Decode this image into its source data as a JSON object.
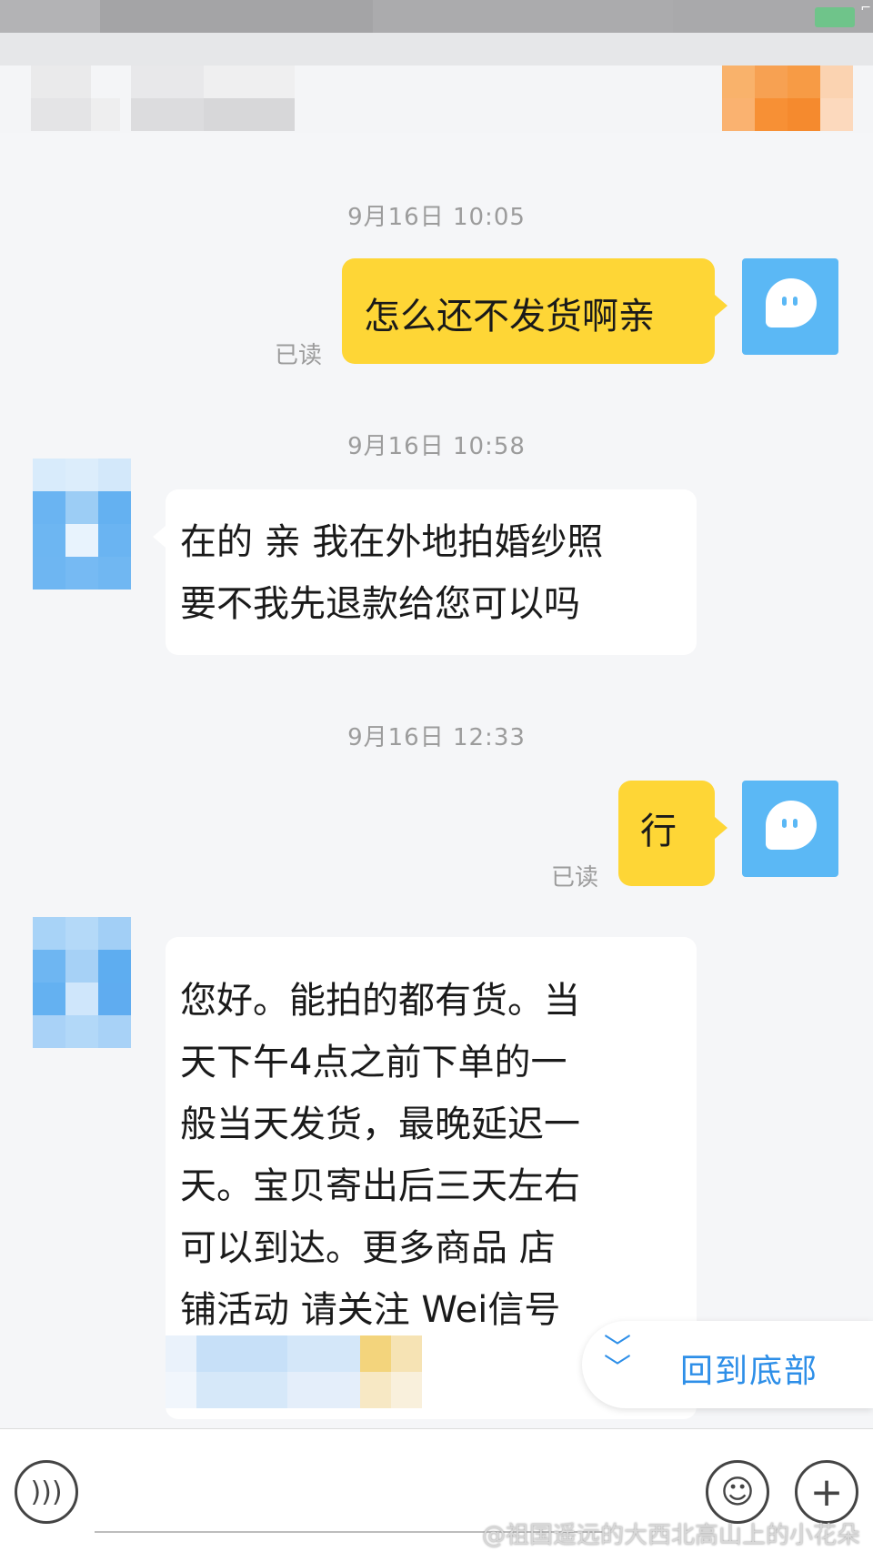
{
  "conversation": [
    {
      "timestamp": "9月16日 10:05"
    },
    {
      "sender": "self",
      "text": "怎么还不发货啊亲",
      "status": "已读"
    },
    {
      "timestamp": "9月16日 10:58"
    },
    {
      "sender": "other",
      "lines": [
        "在的 亲 我在外地拍婚纱照",
        "要不我先退款给您可以吗"
      ]
    },
    {
      "timestamp": "9月16日 12:33"
    },
    {
      "sender": "self",
      "text": "行",
      "status": "已读"
    },
    {
      "sender": "other",
      "lines": [
        "您好。能拍的都有货。当",
        "天下午4点之前下单的一",
        "般当天发货，最晚延迟一",
        "天。宝贝寄出后三天左右",
        "可以到达。更多商品 店",
        "铺活动 请关注 Wei信号"
      ]
    }
  ],
  "back_to_bottom": {
    "label": "回到底部",
    "icon": "double-chevron-down-icon"
  },
  "toolbar": {
    "voice_icon": "voice-icon",
    "emoji_icon": "emoji-icon",
    "plus_icon": "plus-icon"
  },
  "watermark": "@祖国遥远的大西北高山上的小花朵",
  "colors": {
    "outgoing_bubble": "#fed636",
    "incoming_bubble": "#ffffff",
    "accent": "#2e8fe8",
    "self_avatar": "#5bb8f5"
  }
}
